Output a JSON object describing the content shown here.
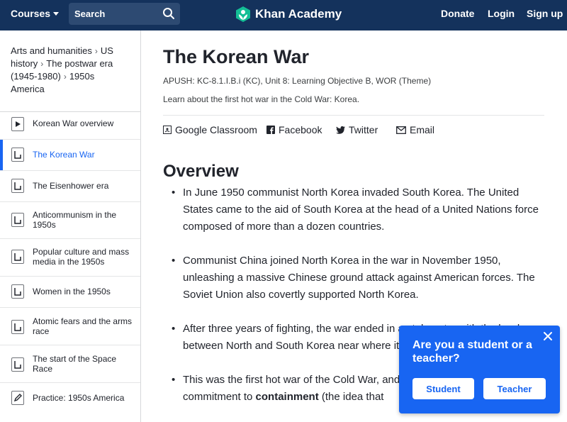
{
  "nav": {
    "courses": "Courses",
    "search_placeholder": "Search",
    "logo": "Khan Academy",
    "donate": "Donate",
    "login": "Login",
    "signup": "Sign up"
  },
  "sidebar": {
    "breadcrumb": [
      "Arts and humanities",
      "US history",
      "The postwar era (1945-1980)",
      "1950s America"
    ],
    "items": [
      {
        "label": "Korean War overview",
        "icon": "video-icon"
      },
      {
        "label": "The Korean War",
        "icon": "article-icon",
        "active": true
      },
      {
        "label": "The Eisenhower era",
        "icon": "article-icon"
      },
      {
        "label": "Anticommunism in the 1950s",
        "icon": "article-icon"
      },
      {
        "label": "Popular culture and mass media in the 1950s",
        "icon": "article-icon"
      },
      {
        "label": "Women in the 1950s",
        "icon": "article-icon"
      },
      {
        "label": "Atomic fears and the arms race",
        "icon": "article-icon"
      },
      {
        "label": "The start of the Space Race",
        "icon": "article-icon"
      },
      {
        "label": "Practice: 1950s America",
        "icon": "pencil-icon"
      }
    ]
  },
  "article": {
    "title": "The Korean War",
    "standards": "APUSH: KC-8.1.I.B.i (KC), Unit 8: Learning Objective B, WOR (Theme)",
    "description": "Learn about the first hot war in the Cold War: Korea.",
    "share": {
      "google": "Google Classroom",
      "facebook": "Facebook",
      "twitter": "Twitter",
      "email": "Email"
    },
    "overview_heading": "Overview",
    "bullets": [
      "In June 1950 communist North Korea invaded South Korea. The United States came to the aid of South Korea at the head of a United Nations force composed of more than a dozen countries.",
      "Communist China joined North Korea in the war in November 1950, unleashing a massive Chinese ground attack against American forces. The Soviet Union also covertly supported North Korea.",
      "After three years of fighting, the war ended in a stalemate, with the border between North and South Korea near where it had been at the beginning.",
      "This was the first hot war of the Cold War, and it demonstrated its continued commitment to containment (the idea that"
    ],
    "bullet4_pre": "This was the first hot war of the Cold War, and it demonstrated its continued commitment to ",
    "bullet4_bold": "containment",
    "bullet4_post": " (the idea that"
  },
  "popup": {
    "question": "Are you a student or a teacher?",
    "student": "Student",
    "teacher": "Teacher"
  },
  "colors": {
    "nav_bg": "#14325c",
    "accent": "#1865f2",
    "logo_green": "#14bf96"
  }
}
